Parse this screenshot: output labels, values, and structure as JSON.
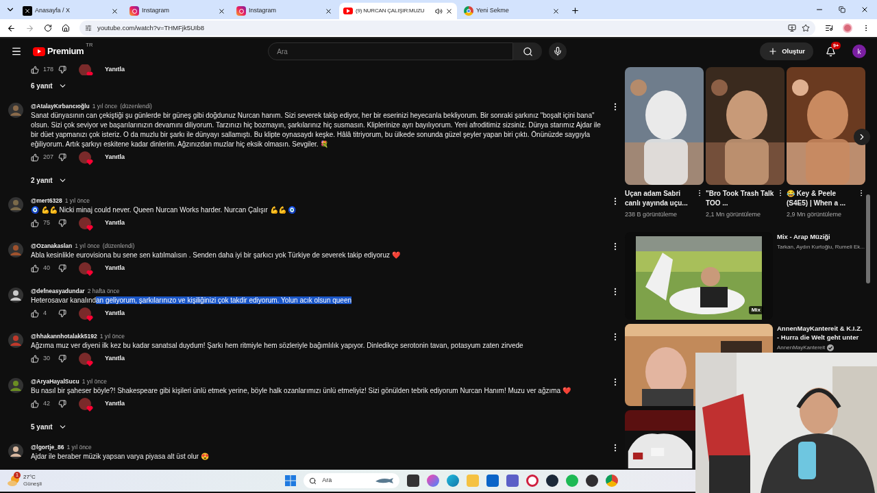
{
  "browser": {
    "tabs": [
      {
        "title": "Anasayfa / X",
        "kind": "x",
        "selected": false,
        "audio": false
      },
      {
        "title": "Instagram",
        "kind": "instagram",
        "selected": false,
        "audio": false
      },
      {
        "title": "Instagram",
        "kind": "instagram",
        "selected": false,
        "audio": false
      },
      {
        "title": "(9) NURCAN ÇALIŞIR:MUZU",
        "kind": "youtube",
        "selected": true,
        "audio": true
      },
      {
        "title": "Yeni Sekme",
        "kind": "chrome",
        "selected": false,
        "audio": false
      }
    ],
    "url": "youtube.com/watch?v=THMFjk5UIb8"
  },
  "header": {
    "logo": "Premium",
    "region": "TR",
    "search_placeholder": "Ara",
    "create": "Oluştur",
    "notifications": "9+",
    "avatar": "k"
  },
  "comments": [
    {
      "kind": "actions",
      "likes": "178",
      "reply": "Yanıtla"
    },
    {
      "kind": "replies",
      "label": "6 yanıt"
    },
    {
      "kind": "comment",
      "author": "@AtalayKırbancıoğlu",
      "time": "1 yıl önce",
      "edited": "(düzenlendi)",
      "text_parts": [
        {
          "text": "Sanat dünyasının can çekiştiği şu günlerde bir güneş gibi doğdunuz Nurcan hanım. Sizi severek takip ediyor, her bir eserinizi heyecanla bekliyorum. Bir sonraki şarkınız \"boşalt içini bana\" olsun. Sizi çok seviyor ve başarılarınızın devamını diliyorum. Tarzınızı hiç bozmayın, şarkılarınız hiç susmasın. Kliplerinize ayrı bayılıyorum. Yeni afroditimiz sizsiniz. Dünya starımız Ajdar ile bir düet yapmanızı çok isteriz. O da muzlu bir şarkı ile dünyayı sallamıştı. Bu klipte oynasaydı keşke. Hâlâ titriyorum, bu ülkede sonunda güzel şeyler yapan biri çıktı. Önünüzde saygıyla eğiliyorum. Artık şarkıyı eskitene kadar dinlerim. Ağzınızdan muzlar hiç eksik olmasın. Sevgiler. 💐",
          "selected": false
        }
      ],
      "likes": "207",
      "reply": "Yanıtla"
    },
    {
      "kind": "replies",
      "label": "2 yanıt"
    },
    {
      "kind": "comment",
      "author": "@mert6328",
      "time": "1 yıl önce",
      "text_parts": [
        {
          "text": "🧿 💪💪 Nicki minaj could never. Queen Nurcan Works harder. Nurcan Çalışır 💪💪 🧿",
          "selected": false
        }
      ],
      "likes": "75",
      "reply": "Yanıtla"
    },
    {
      "kind": "comment",
      "author": "@Ozanakaslan",
      "time": "1 yıl önce",
      "edited": "(düzenlendi)",
      "text_parts": [
        {
          "text": "Abla kesinlikle eurovisiona bu sene sen katılmalısın . Senden daha iyi bir şarkıcı yok Türkiye de severek takip ediyoruz ❤️",
          "selected": false
        }
      ],
      "likes": "40",
      "reply": "Yanıtla"
    },
    {
      "kind": "comment",
      "author": "@defneasyadundar",
      "time": "2 hafta önce",
      "text_parts": [
        {
          "text": "Heterosavar kanalınd",
          "selected": false
        },
        {
          "text": "an geliyorum,  şarkılarınızo ve kişiliğinizi çok takdir ediyorum. Yolun acık olsun queen",
          "selected": true
        }
      ],
      "likes": "4",
      "reply": "Yanıtla"
    },
    {
      "kind": "comment",
      "author": "@hhakannhotalakk5192",
      "time": "1 yıl önce",
      "text_parts": [
        {
          "text": "Ağzıma muz ver diyeni ilk kez bu kadar sanatsal duydum! Şarkı hem ritmiyle hem sözleriyle bağımlılık yapıyor. Dinledikçe serotonin tavan, potasyum zaten zirvede",
          "selected": false
        }
      ],
      "likes": "30",
      "reply": "Yanıtla"
    },
    {
      "kind": "comment",
      "author": "@AryaHayalSucu",
      "time": "1 yıl önce",
      "text_parts": [
        {
          "text": "Bu nasıl bir şaheser böyle?! Shakespeare gibi kişileri ünlü etmek yerine, böyle halk ozanlarımızı ünlü etmeliyiz! Sizi gönülden tebrik ediyorum Nurcan Hanım! Muzu ver ağzıma ❤️",
          "selected": false
        }
      ],
      "likes": "42",
      "reply": "Yanıtla"
    },
    {
      "kind": "replies",
      "label": "5 yanıt"
    },
    {
      "kind": "comment",
      "author": "@lgortje_86",
      "time": "1 yıl önce",
      "text_parts": [
        {
          "text": "Ajdar ile beraber müzik yapsan varya piyasa alt üst olur 😍",
          "selected": false
        }
      ]
    }
  ],
  "shorts": [
    {
      "title": "Uçan adam Sabri canlı yayında uçu...",
      "views": "238 B görüntüleme"
    },
    {
      "title": "\"Bro Took Trash Talk TOO ...",
      "views": "2,1 Mn görüntüleme"
    },
    {
      "title": "😂 Key & Peele (S4E5) | When a ...",
      "views": "2,9 Mn görüntüleme"
    }
  ],
  "videos": [
    {
      "title": "Mix - Arap Müziği",
      "subtitle": "Tarkan, Aydın Kurtoğlu, Rumeli Ek...",
      "badge": "Mix",
      "verified": false
    },
    {
      "title": "AnnenMayKantereit & K.I.Z. - Hurra die Welt geht unter",
      "subtitle": "AnnenMayKantereit",
      "verified": true
    },
    {
      "kind": "picture"
    }
  ],
  "taskbar": {
    "temperature": "27°C",
    "weather": "Güneşli",
    "weather_badge": "1",
    "search_placeholder": "Ara"
  }
}
